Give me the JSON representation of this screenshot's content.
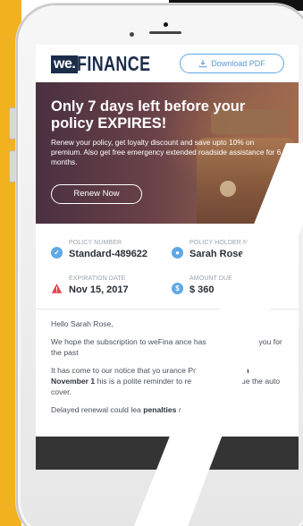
{
  "header": {
    "logo_prefix": "we.",
    "logo_word": "FINANCE",
    "download_label": "Download PDF",
    "download_icon": "download-icon"
  },
  "hero": {
    "title": "Only 7 days left before your policy EXPIRES!",
    "text": "Renew your policy, get loyalty discount and save upto 10% on premium. Also get free emergency extended roadside assistance for 6 months.",
    "cta": "Renew Now"
  },
  "policy": {
    "number_label": "POLICY NUMBER",
    "number_value": "Standard-489622",
    "holder_label": "POLICY HOLDER N",
    "holder_value": "Sarah Rose",
    "expiration_label": "EXPIRATION DATE",
    "expiration_value": "Nov 15, 2017",
    "amount_label": "AMOUNT DUE",
    "amount_value": "$ 360"
  },
  "letter": {
    "greeting": "Hello Sarah Rose,",
    "p1": "We hope the subscription to weFina        ance has been useful to you for the past",
    "p2_start": "It has come to our notice that yo        urance Policy ",
    "p2_bold": "expires on November 1",
    "p2_end": "       his is a polite reminder to renew your        ontinue the auto cover.",
    "p3_start": "Delayed renewal could lea",
    "p3_bold": "penalties and"
  },
  "colors": {
    "accent": "#5fa8e6",
    "brand_dark": "#1c2d4a",
    "alert_red": "#e2454b",
    "side_yellow": "#f2b21f",
    "footer_dark": "#343434"
  }
}
